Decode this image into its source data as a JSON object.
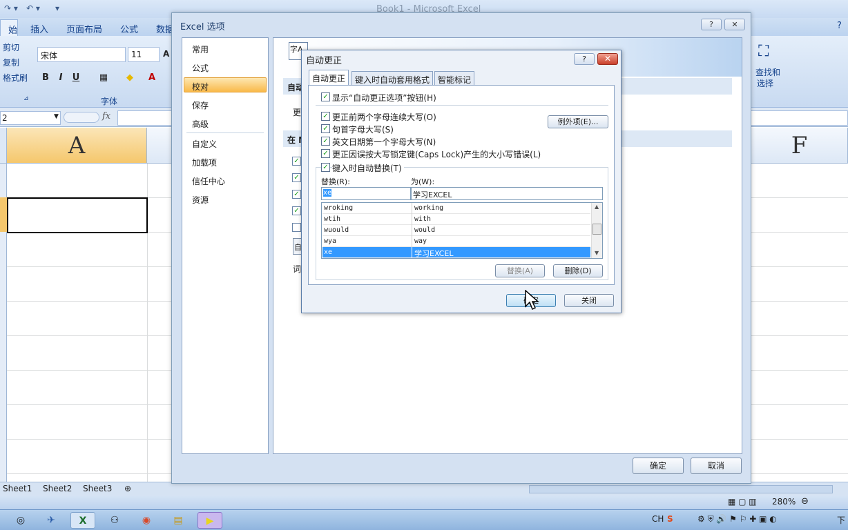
{
  "excel": {
    "title": "Book1 - Microsoft Excel",
    "tabs": [
      "始",
      "插入",
      "页面布局",
      "公式",
      "数据"
    ],
    "ribbon": {
      "cut": "剪切",
      "copy": "复制",
      "format_painter": "格式刷",
      "font_name": "宋体",
      "font_size": "11",
      "font_group": "字体",
      "find_select": "查找和\n选择",
      "find_select_1": "查找和",
      "find_select_2": "选择"
    },
    "name_box": "2",
    "fx": "fx",
    "columns": [
      "A",
      "F"
    ],
    "sheets": [
      "Sheet1",
      "Sheet2",
      "Sheet3"
    ],
    "zoom": "280%"
  },
  "options_dialog": {
    "title": "Excel 选项",
    "nav": [
      "常用",
      "公式",
      "校对",
      "保存",
      "高级",
      "自定义",
      "加载项",
      "信任中心",
      "资源"
    ],
    "selected_nav": "校对",
    "section1_prefix": "自动",
    "row_prefix": "更",
    "section2_prefix": "在 M",
    "btn_stub": "自",
    "dict_prefix": "词",
    "ok": "确定",
    "cancel": "取消",
    "banner_icon": "字A"
  },
  "autocorrect_dialog": {
    "title": "自动更正",
    "tabs": [
      "自动更正",
      "键入时自动套用格式",
      "智能标记"
    ],
    "show_options_button": "显示“自动更正选项”按钮(H)",
    "checks": [
      {
        "label": "更正前两个字母连续大写(O)",
        "checked": true
      },
      {
        "label": "句首字母大写(S)",
        "checked": true
      },
      {
        "label": "英文日期第一个字母大写(N)",
        "checked": true
      },
      {
        "label": "更正因误按大写锁定键(Caps Lock)产生的大小写错误(L)",
        "checked": true
      }
    ],
    "exceptions_button": "例外项(E)...",
    "replace_as_you_type": "键入时自动替换(T)",
    "replace_label": "替换(R):",
    "with_label": "为(W):",
    "replace_value": "xe",
    "with_value": "学习EXCEL",
    "entries": [
      {
        "replace": "wroking",
        "with": "working"
      },
      {
        "replace": "wtih",
        "with": "with"
      },
      {
        "replace": "wuould",
        "with": "would"
      },
      {
        "replace": "wya",
        "with": "way"
      },
      {
        "replace": "xe",
        "with": "学习EXCEL"
      }
    ],
    "selected_entry": 4,
    "replace_button": "替换(A)",
    "delete_button": "删除(D)",
    "ok": "确定",
    "close": "关闭"
  },
  "taskbar": {
    "lang": "CH",
    "clock": "下"
  }
}
